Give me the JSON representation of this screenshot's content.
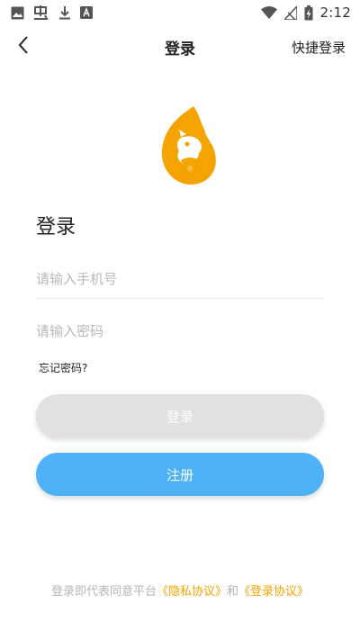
{
  "status_bar": {
    "time": "2:12",
    "left_icons": [
      "image-icon",
      "chinese-char-icon",
      "download-icon",
      "a-box-icon"
    ],
    "right_icons": [
      "wifi-icon",
      "signal-icon",
      "battery-charging-icon"
    ]
  },
  "app_bar": {
    "back_icon": "chevron-left-icon",
    "title": "登录",
    "quick_login": "快捷登录"
  },
  "logo": {
    "icon": "squirrel-flame-logo",
    "color": "#f4a300"
  },
  "form": {
    "heading": "登录",
    "phone_placeholder": "请输入手机号",
    "phone_value": "",
    "password_placeholder": "请输入密码",
    "password_value": "",
    "forgot_password": "忘记密码?",
    "login_button": "登录",
    "register_button": "注册"
  },
  "agreement": {
    "prefix": "登录即代表同意平台",
    "privacy_link": "《隐私协议》",
    "and": "和",
    "login_link": "《登录协议》"
  },
  "colors": {
    "accent_orange": "#f4a300",
    "register_blue": "#4db2f7",
    "login_disabled_gray": "#e1e1e1"
  }
}
